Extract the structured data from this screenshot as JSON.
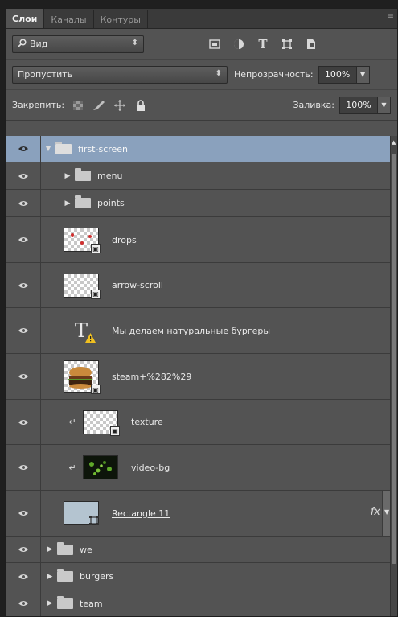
{
  "tabs": [
    "Слои",
    "Каналы",
    "Контуры"
  ],
  "panel_menu_icon": "≡",
  "filter": {
    "kind_label": "Вид",
    "search_icon": "search-icon"
  },
  "blend": {
    "mode": "Пропустить",
    "opacity_label": "Непрозрачность:",
    "opacity_value": "100%"
  },
  "lock": {
    "label": "Закрепить:",
    "fill_label": "Заливка:",
    "fill_value": "100%"
  },
  "layers": {
    "first_screen": "first-screen",
    "menu": "menu",
    "points": "points",
    "drops": "drops",
    "arrow_scroll": "arrow-scroll",
    "text_layer": "Мы делаем натуральные бургеры",
    "steam": "steam+%282%29",
    "texture": "texture",
    "video_bg": "video-bg",
    "rectangle": "Rectangle 11",
    "we": "we",
    "burgers": "burgers",
    "team": "team"
  },
  "fx_label": "fx",
  "colors": {
    "selected_row": "#8aa1bd",
    "panel": "#535353"
  }
}
